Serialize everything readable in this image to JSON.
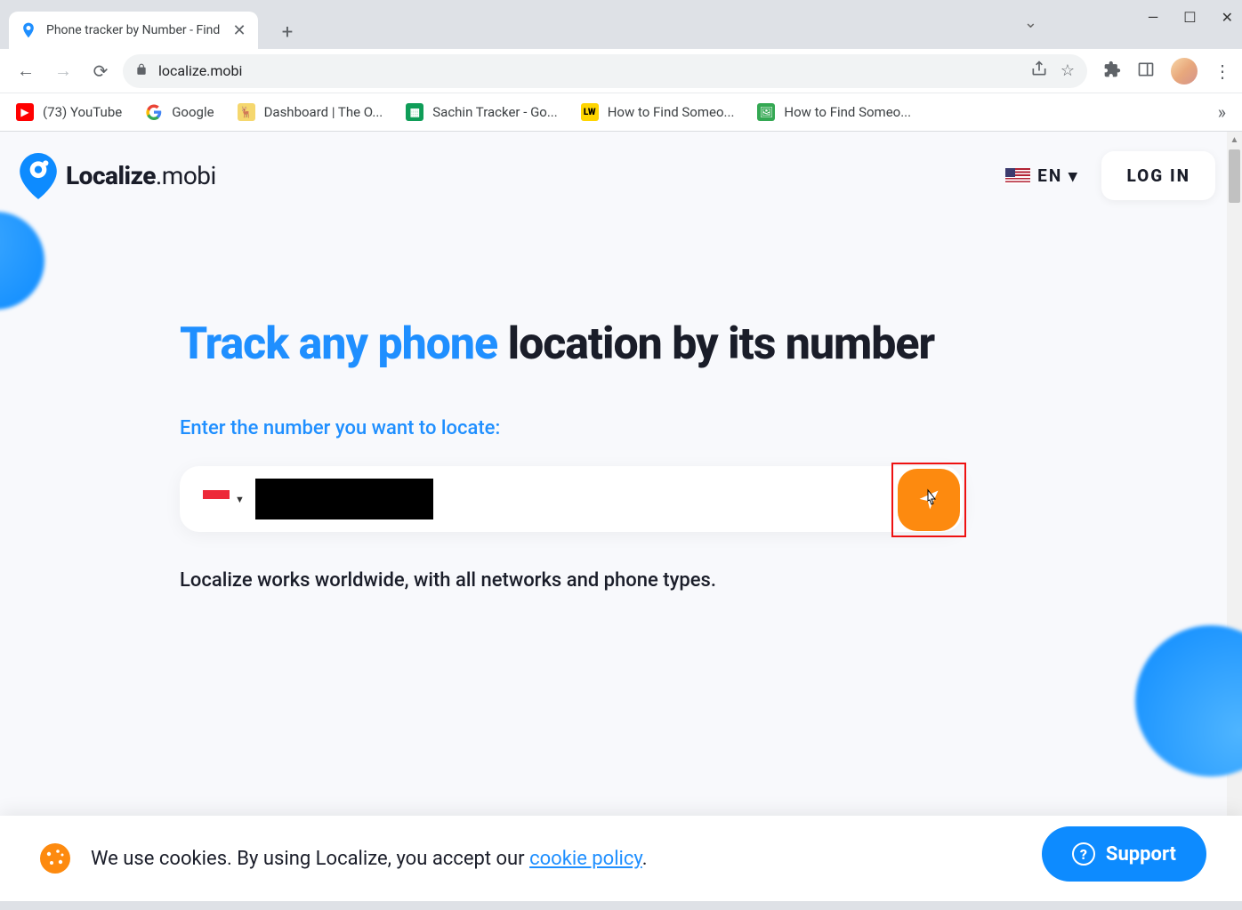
{
  "browser": {
    "tab_title": "Phone tracker by Number - Find",
    "url": "localize.mobi",
    "bookmarks": [
      {
        "label": "(73) YouTube"
      },
      {
        "label": "Google"
      },
      {
        "label": "Dashboard | The O..."
      },
      {
        "label": "Sachin Tracker - Go..."
      },
      {
        "label": "How to Find Someo..."
      },
      {
        "label": "How to Find Someo..."
      }
    ]
  },
  "header": {
    "logo_bold": "Localize",
    "logo_light": ".mobi",
    "lang_label": "EN ▾",
    "login_label": "LOG IN"
  },
  "hero": {
    "title_blue": "Track any phone",
    "title_rest": " location by its number",
    "prompt": "Enter the number you want to locate:",
    "subtext": "Localize works worldwide, with all networks and phone types."
  },
  "cookie": {
    "text_prefix": "We use cookies. By using Localize, you accept our ",
    "link_text": "cookie policy",
    "text_suffix": "."
  },
  "support": {
    "label": "Support"
  }
}
